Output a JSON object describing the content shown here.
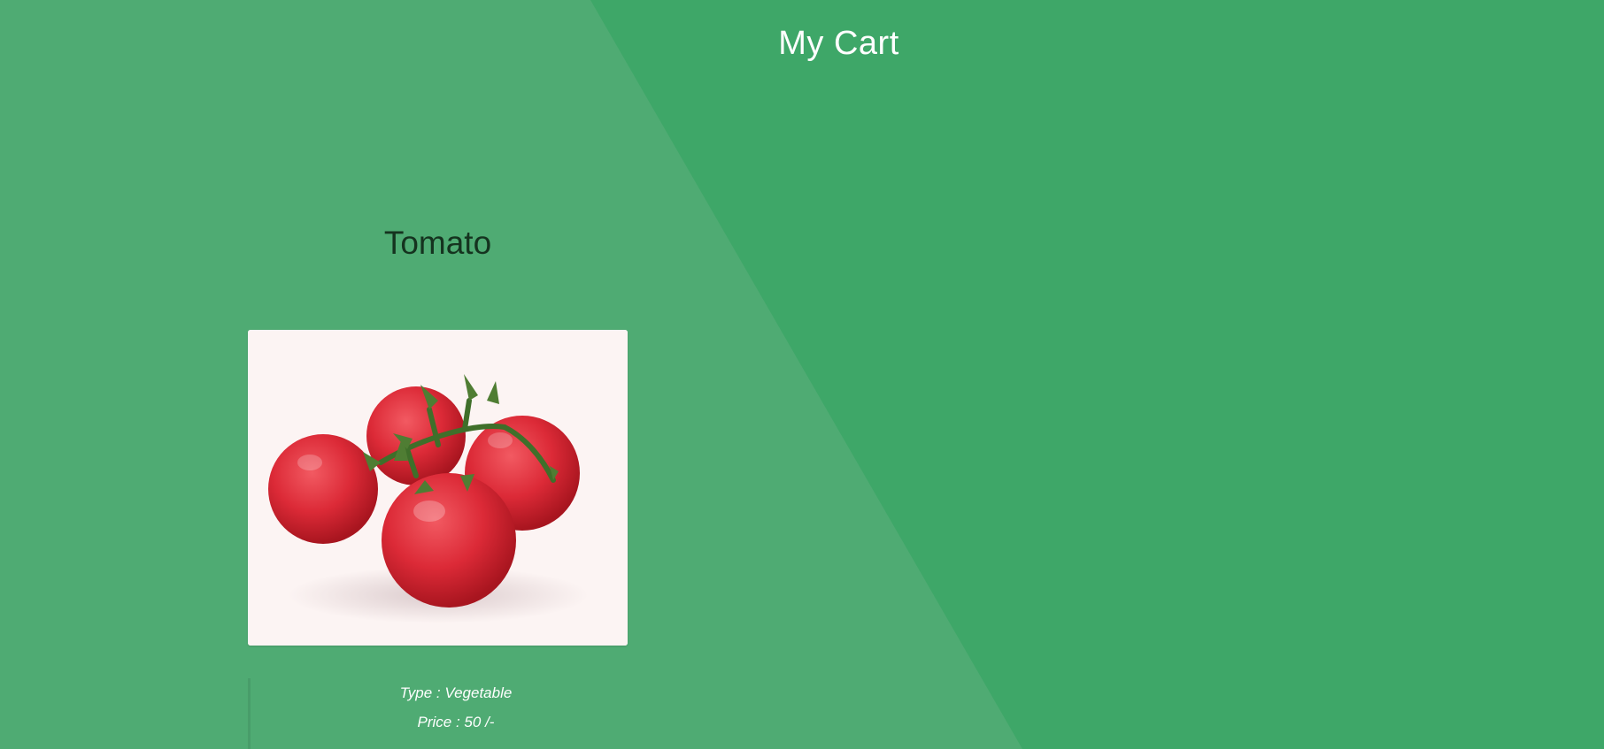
{
  "page": {
    "title": "My Cart",
    "colors": {
      "background": "#3ea768",
      "diagonal_panel": "#4fab73",
      "title_text": "#ffffff",
      "product_name_text": "#15331f"
    }
  },
  "cart": {
    "items": [
      {
        "name": "Tomato",
        "image_icon": "tomato-image",
        "type_text": "Type : Vegetable",
        "price_text": "Price : 50 /-"
      }
    ]
  }
}
